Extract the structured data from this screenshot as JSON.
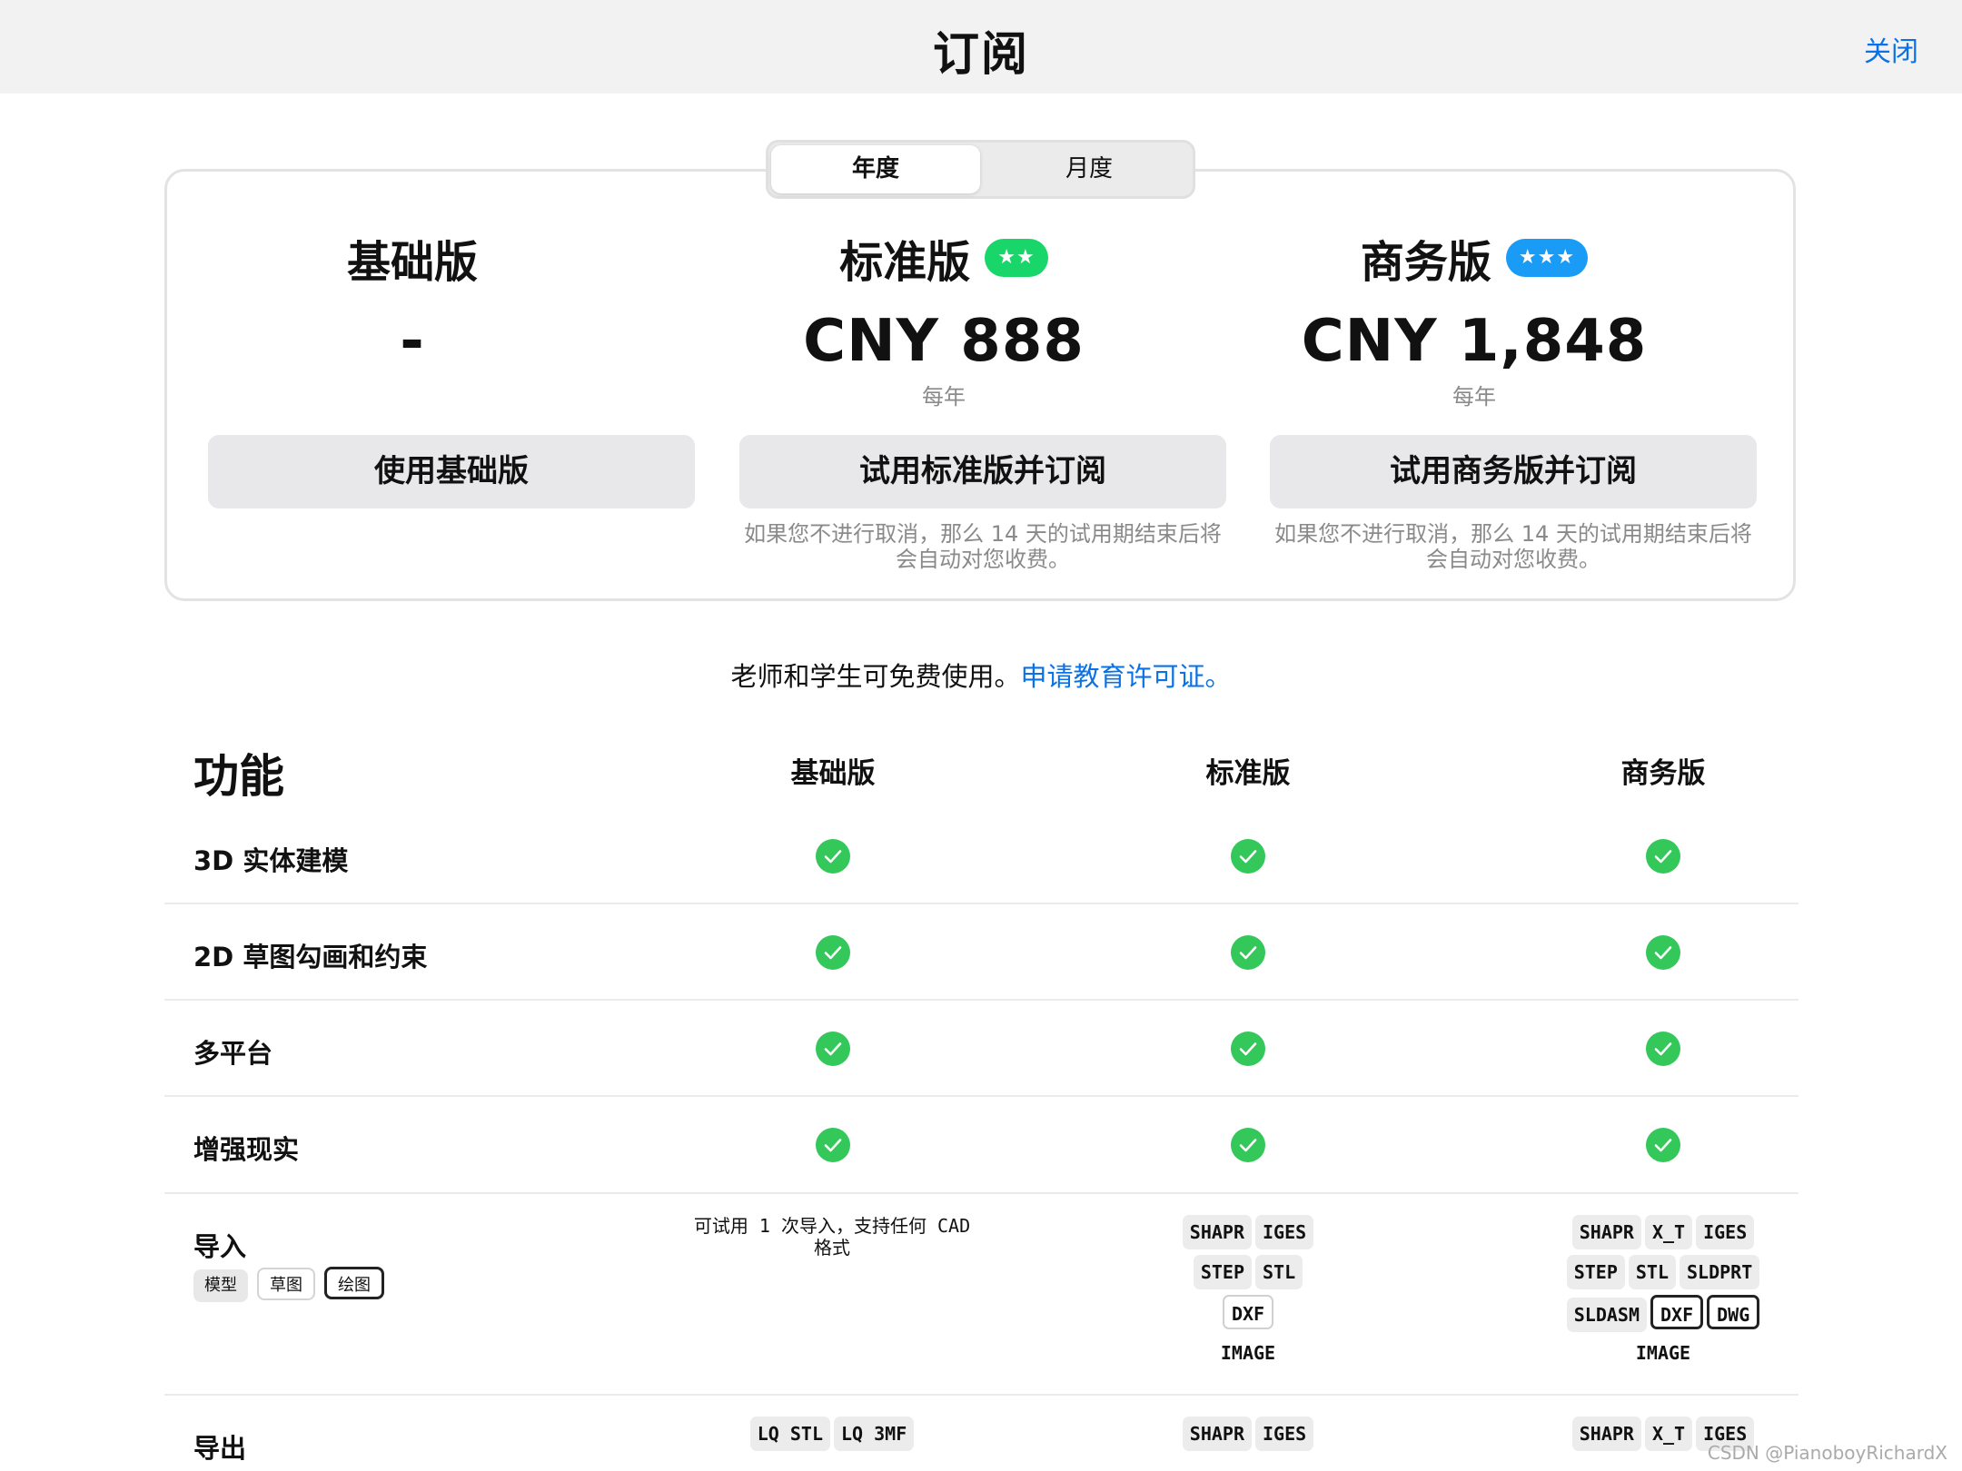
{
  "header": {
    "title": "订阅",
    "close_label": "关闭"
  },
  "billing_toggle": {
    "options": [
      "年度",
      "月度"
    ],
    "selected": "年度"
  },
  "plans": [
    {
      "name": "基础版",
      "badge": "",
      "price": "-",
      "period": "",
      "button": "使用基础版",
      "note": ""
    },
    {
      "name": "标准版",
      "badge": "★★",
      "badge_color": "#19d66a",
      "price": "CNY 888",
      "period": "每年",
      "button": "试用标准版并订阅",
      "note": "如果您不进行取消，那么 14 天的试用期结束后将会自动对您收费。"
    },
    {
      "name": "商务版",
      "badge": "★★★",
      "badge_color": "#1a9bf5",
      "price": "CNY 1,848",
      "period": "每年",
      "button": "试用商务版并订阅",
      "note": "如果您不进行取消，那么 14 天的试用期结束后将会自动对您收费。"
    }
  ],
  "education": {
    "text": "老师和学生可免费使用。",
    "link": "申请教育许可证。"
  },
  "features": {
    "title": "功能",
    "columns": [
      "基础版",
      "标准版",
      "商务版"
    ],
    "rows": [
      "3D 实体建模",
      "2D 草图勾画和约束",
      "多平台",
      "增强现实"
    ],
    "included": [
      [
        true,
        true,
        true
      ],
      [
        true,
        true,
        true
      ],
      [
        true,
        true,
        true
      ],
      [
        true,
        true,
        true
      ]
    ],
    "import": {
      "label": "导入",
      "tags": [
        "模型",
        "草图",
        "绘图"
      ],
      "basic_note": "可试用 1 次导入，支持任何 CAD 格式",
      "standard": [
        [
          "SHAPR",
          "IGES"
        ],
        [
          "STEP",
          "STL"
        ],
        [
          "DXF"
        ],
        [
          "IMAGE"
        ]
      ],
      "business": [
        [
          "SHAPR",
          "X_T",
          "IGES"
        ],
        [
          "STEP",
          "STL",
          "SLDPRT"
        ],
        [
          "SLDASM",
          "DXF",
          "DWG"
        ],
        [
          "IMAGE"
        ]
      ]
    },
    "export": {
      "label": "导出",
      "basic": [
        "LQ STL",
        "LQ 3MF"
      ],
      "standard": [
        "SHAPR",
        "IGES"
      ],
      "business": [
        "SHAPR",
        "X_T",
        "IGES"
      ]
    }
  },
  "watermark": "CSDN @PianoboyRichardX"
}
